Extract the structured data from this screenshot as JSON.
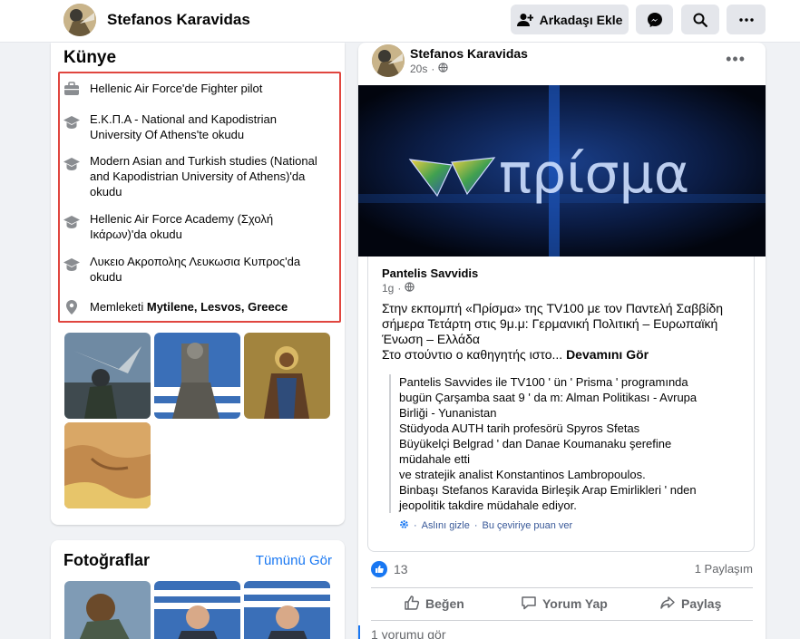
{
  "header": {
    "profile_name": "Stefanos Karavidas",
    "add_friend_label": "Arkadaşı Ekle",
    "icons": [
      "add-friend-icon",
      "messenger-icon",
      "search-icon",
      "more-icon"
    ]
  },
  "intro": {
    "title": "Künye",
    "items": [
      {
        "icon": "briefcase-icon",
        "text": "Hellenic Air Force'de Fighter pilot"
      },
      {
        "icon": "graduation-cap-icon",
        "text": "Ε.Κ.Π.Α - National and Kapodistrian University Of Athens'te okudu"
      },
      {
        "icon": "graduation-cap-icon",
        "text": "Modern Asian and Turkish studies (National and Kapodistrian University of Athens)'da okudu"
      },
      {
        "icon": "graduation-cap-icon",
        "text": "Hellenic Air Force Academy (Σχολή Ικάρων)'da okudu"
      },
      {
        "icon": "graduation-cap-icon",
        "text": "Λυκειο Ακροπολης Λευκωσια Κυπρος'da okudu"
      }
    ],
    "hometown_label": "Memleketi",
    "hometown_value": "Mytilene, Lesvos, Greece"
  },
  "photos": {
    "title": "Fotoğraflar",
    "see_all_label": "Tümünü Gör"
  },
  "post": {
    "author": "Stefanos Karavidas",
    "time": "20s",
    "more_label": "•••",
    "image_text": "πρίσμα",
    "shared": {
      "author": "Pantelis Savvidis",
      "time": "1g",
      "text_line1": "Στην εκπομπή «Πρίσμα» της TV100 με τον Παντελή Σαββίδη σήμερα Τετάρτη στις 9μ.μ: Γερμανική Πολιτική – Ευρωπαϊκή Ένωση – Ελλάδα",
      "text_line2": "Στο στούντιο ο καθηγητής ιστο...",
      "see_more": "Devamını Gör",
      "translation_lines": [
        "Pantelis Savvides ile TV100 ' ün ' Prisma ' programında",
        "bugün Çarşamba saat 9 ' da m: Alman Politikası - Avrupa",
        "Birliği - Yunanistan",
        "Stüdyoda AUTH tarih profesörü Spyros Sfetas",
        "Büyükelçi Belgrad ' dan Danae Koumanaku şerefine",
        "müdahale etti",
        "ve stratejik analist Konstantinos Lambropoulos.",
        "Binbaşı Stefanos Karavida Birleşik Arap Emirlikleri ' nden",
        "jeopolitik takdire müdahale ediyor."
      ],
      "hide_original": "Aslını gizle",
      "rate_translation": "Bu çeviriye puan ver",
      "separator": "·"
    },
    "like_count": "13",
    "share_count": "1 Paylaşım",
    "actions": {
      "like": "Beğen",
      "comment": "Yorum Yap",
      "share": "Paylaş"
    },
    "comments_link": "1 yorumu gör"
  },
  "colors": {
    "accent": "#1877f2",
    "highlight_box": "#e0463f"
  }
}
